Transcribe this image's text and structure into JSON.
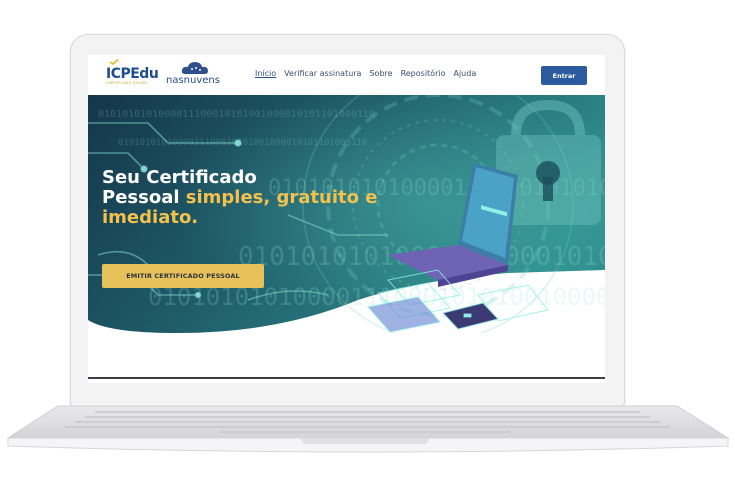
{
  "header": {
    "logo_icp": "ICPEdu",
    "logo_icp_tagline": "CERTIFICADO DIGITAL",
    "logo_nuvens": "nasnuvens",
    "nav": [
      "Início",
      "Verificar assinatura",
      "Sobre",
      "Repositório",
      "Ajuda"
    ],
    "active_nav": "Início",
    "login_button": "Entrar"
  },
  "hero": {
    "title_line1": "Seu Certificado",
    "title_line2_white": "Pessoal ",
    "title_line2_highlight": "simples, gratuito e",
    "title_line3_highlight": "imediato.",
    "cta_button": "EMITIR CERTIFICADO PESSOAL",
    "background_binary": "0101010101000011100010101001000010101101000110"
  },
  "colors": {
    "primary": "#2b5a9e",
    "accent": "#f2c14e",
    "hero_dark": "#12394a",
    "hero_teal": "#2d8c8f"
  },
  "icons": [
    "cloud-logo-icon",
    "check-mark-icon",
    "padlock-icon",
    "laptop-illustration",
    "card-illustration"
  ]
}
